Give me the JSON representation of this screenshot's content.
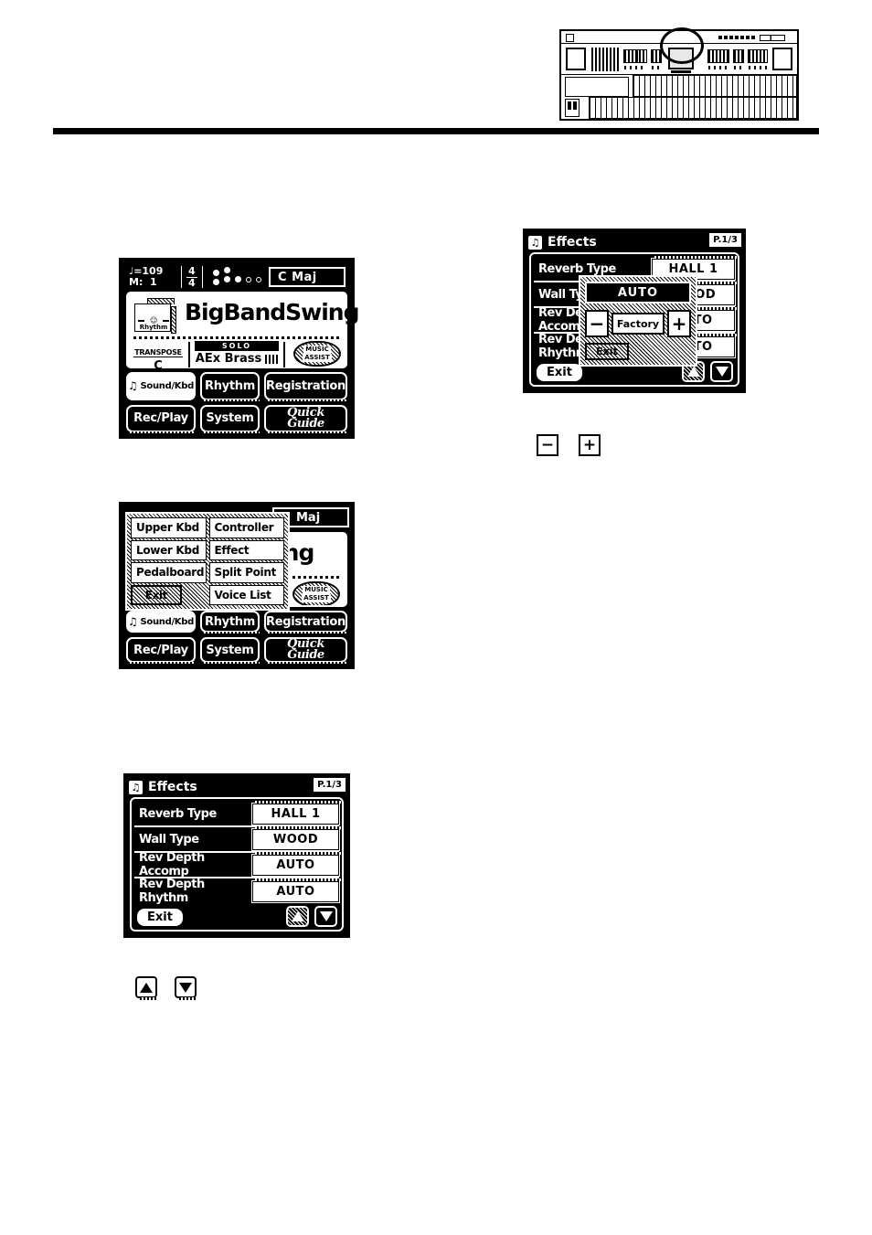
{
  "page": {
    "illustration": {
      "name": "electronic-organ-front-panel",
      "highlight": "lcd-display-panel"
    }
  },
  "screen_main": {
    "status": {
      "tempo_label": "♩=109",
      "measure_label": "M:",
      "measure_value": "1",
      "time_sig_top": "4",
      "time_sig_bottom": "4",
      "chord": "C Maj",
      "beat_dots_on": 5,
      "beat_dots_off": 2
    },
    "rhythm_icon_label": "Rhythm",
    "title": "BigBandSwing",
    "transpose": {
      "label": "TRANSPOSE",
      "value": "C"
    },
    "solo": {
      "label": "SOLO",
      "value": "AEx Brass"
    },
    "music_assist": {
      "line1": "MUSIC",
      "line2": "ASSIST"
    },
    "buttons": [
      {
        "label": "Sound/Kbd",
        "selected": true,
        "icon": "music-note-icon"
      },
      {
        "label": "Rhythm",
        "selected": false
      },
      {
        "label": "Registration",
        "selected": false
      },
      {
        "label": "Rec/Play",
        "selected": false
      },
      {
        "label": "System",
        "selected": false
      },
      {
        "label": "Quick",
        "label2": "Guide",
        "selected": false,
        "style": "quick-guide"
      }
    ]
  },
  "screen_menu": {
    "status_chord": "Maj",
    "card_title_fragment": "wing",
    "music_assist": {
      "line1": "MUSIC",
      "line2": "ASSIST"
    },
    "overlay_items": [
      {
        "label": "Upper Kbd"
      },
      {
        "label": "Controller"
      },
      {
        "label": "Lower Kbd"
      },
      {
        "label": "Effect"
      },
      {
        "label": "Pedalboard"
      },
      {
        "label": "Split Point"
      },
      {
        "label": "Exit",
        "kind": "exit"
      },
      {
        "label": "Voice List"
      }
    ],
    "buttons": [
      {
        "label": "Sound/Kbd",
        "selected": true,
        "icon": "music-note-icon"
      },
      {
        "label": "Rhythm",
        "selected": false
      },
      {
        "label": "Registration",
        "selected": false
      },
      {
        "label": "Rec/Play",
        "selected": false
      },
      {
        "label": "System",
        "selected": false
      },
      {
        "label": "Quick",
        "label2": "Guide",
        "selected": false,
        "style": "quick-guide"
      }
    ]
  },
  "screen_effects_popup": {
    "title": "Effects",
    "page_badge": "P.1/3",
    "rows": [
      {
        "label": "Reverb Type",
        "value": "HALL 1"
      },
      {
        "label": "Wall Type",
        "value": "WOOD"
      },
      {
        "label": "Rev Depth Accomp",
        "value": "AUTO"
      },
      {
        "label": "Rev Depth Rhythm",
        "value": "AUTO"
      }
    ],
    "exit_label": "Exit",
    "popup": {
      "value": "AUTO",
      "minus_label": "−",
      "factory_label": "Factory",
      "plus_label": "+",
      "exit_label": "Exit"
    }
  },
  "screen_effects": {
    "title": "Effects",
    "page_badge": "P.1/3",
    "rows": [
      {
        "label": "Reverb Type",
        "value": "HALL 1"
      },
      {
        "label": "Wall Type",
        "value": "WOOD"
      },
      {
        "label": "Rev Depth Accomp",
        "value": "AUTO"
      },
      {
        "label": "Rev Depth Rhythm",
        "value": "AUTO"
      }
    ],
    "exit_label": "Exit"
  },
  "key_icons": {
    "minus": "−",
    "plus": "+",
    "up": "up-triangle",
    "down": "down-triangle"
  }
}
